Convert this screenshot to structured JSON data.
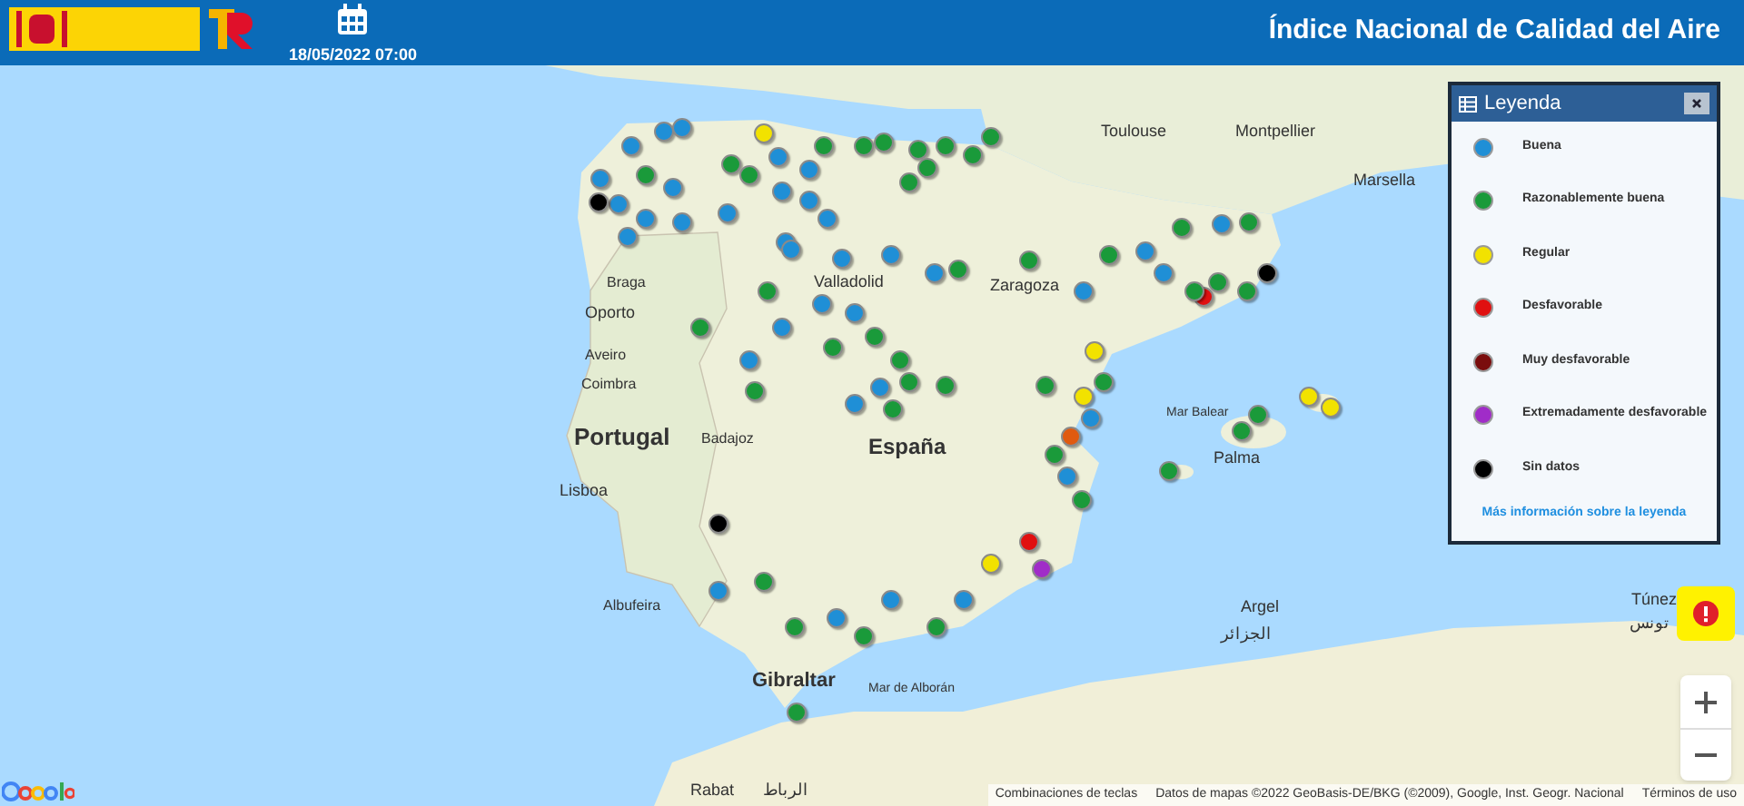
{
  "header": {
    "date": "18/05/2022 07:00",
    "title": "Índice Nacional de Calidad del Aire"
  },
  "map_labels": [
    "Toulouse",
    "Montpellier",
    "Marsella",
    "Braga",
    "Oporto",
    "Aveiro",
    "Coimbra",
    "Portugal",
    "Badajoz",
    "Lisboa",
    "Albufeira",
    "España",
    "Valladolid",
    "Zaragoza",
    "Mar Balear",
    "Palma",
    "Argel",
    "الجزائر",
    "Túnez",
    "تونس",
    "Mar de Alborán",
    "Gibraltar",
    "Rabat",
    "الرباط"
  ],
  "stations": [
    {
      "color": "#1f8fd6"
    },
    {
      "color": "#1f8fd6"
    },
    {
      "color": "#1f8fd6"
    },
    {
      "color": "#1f8fd6"
    },
    {
      "color": "#1f8fd6"
    },
    {
      "color": "#1a9a3a"
    },
    {
      "color": "#1f8fd6"
    },
    {
      "color": "#1f8fd6"
    },
    {
      "color": "#1f8fd6"
    },
    {
      "color": "#1f8fd6"
    },
    {
      "color": "#000000"
    },
    {
      "color": "#f2e200"
    },
    {
      "color": "#1a9a3a"
    },
    {
      "color": "#1a9a3a"
    },
    {
      "color": "#1f8fd6"
    },
    {
      "color": "#1f8fd6"
    },
    {
      "color": "#1a9a3a"
    },
    {
      "color": "#1a9a3a"
    },
    {
      "color": "#1a9a3a"
    },
    {
      "color": "#1a9a3a"
    },
    {
      "color": "#1a9a3a"
    },
    {
      "color": "#1a9a3a"
    },
    {
      "color": "#1a9a3a"
    },
    {
      "color": "#1a9a3a"
    },
    {
      "color": "#1f8fd6"
    },
    {
      "color": "#1a9a3a"
    },
    {
      "color": "#1f8fd6"
    },
    {
      "color": "#1f8fd6"
    },
    {
      "color": "#1f8fd6"
    },
    {
      "color": "#1f8fd6"
    },
    {
      "color": "#1f8fd6"
    },
    {
      "color": "#1f8fd6"
    },
    {
      "color": "#1f8fd6"
    },
    {
      "color": "#1f8fd6"
    },
    {
      "color": "#1a9a3a"
    },
    {
      "color": "#1f8fd6"
    },
    {
      "color": "#1a9a3a"
    },
    {
      "color": "#1f8fd6"
    },
    {
      "color": "#1f8fd6"
    },
    {
      "color": "#1a9a3a"
    },
    {
      "color": "#1a9a3a"
    },
    {
      "color": "#1f8fd6"
    },
    {
      "color": "#1a9a3a"
    },
    {
      "color": "#1a9a3a"
    },
    {
      "color": "#1a9a3a"
    },
    {
      "color": "#1a9a3a"
    },
    {
      "color": "#1f8fd6"
    },
    {
      "color": "#1a9a3a"
    },
    {
      "color": "#1f8fd6"
    },
    {
      "color": "#1a9a3a"
    },
    {
      "color": "#e01010"
    },
    {
      "color": "#000000"
    },
    {
      "color": "#f2e200"
    },
    {
      "color": "#f2e200"
    },
    {
      "color": "#e05a10"
    },
    {
      "color": "#1a9a3a"
    },
    {
      "color": "#1f8fd6"
    },
    {
      "color": "#1a9a3a"
    },
    {
      "color": "#1f8fd6"
    },
    {
      "color": "#1a9a3a"
    },
    {
      "color": "#f2e200"
    },
    {
      "color": "#f2e200"
    },
    {
      "color": "#1a9a3a"
    },
    {
      "color": "#1a9a3a"
    },
    {
      "color": "#1a9a3a"
    },
    {
      "color": "#1f8fd6"
    },
    {
      "color": "#1a9a3a"
    },
    {
      "color": "#1f8fd6"
    },
    {
      "color": "#1a9a3a"
    },
    {
      "color": "#1a9a3a"
    },
    {
      "color": "#1a9a3a"
    },
    {
      "color": "#1a9a3a"
    },
    {
      "color": "#1f8fd6"
    },
    {
      "color": "#f2e200"
    },
    {
      "color": "#e01010"
    },
    {
      "color": "#a02cc8"
    },
    {
      "color": "#1a9a3a"
    },
    {
      "color": "#1a9a3a"
    },
    {
      "color": "#1f8fd6"
    },
    {
      "color": "#1a9a3a"
    },
    {
      "color": "#1a9a3a"
    },
    {
      "color": "#1a9a3a"
    },
    {
      "color": "#1f8fd6"
    },
    {
      "color": "#1f8fd6"
    },
    {
      "color": "#1a9a3a"
    },
    {
      "color": "#000000"
    },
    {
      "color": "#1f8fd6"
    },
    {
      "color": "#1a9a3a"
    },
    {
      "color": "#1f8fd6"
    },
    {
      "color": "#1a9a3a"
    }
  ],
  "legend": {
    "title": "Leyenda",
    "items": [
      {
        "label": "Buena",
        "color": "#1f8fd6"
      },
      {
        "label": "Razonablemente buena",
        "color": "#1a9a3a"
      },
      {
        "label": "Regular",
        "color": "#f2e200"
      },
      {
        "label": "Desfavorable",
        "color": "#e01010"
      },
      {
        "label": "Muy desfavorable",
        "color": "#7a0d0d"
      },
      {
        "label": "Extremadamente desfavorable",
        "color": "#a02cc8"
      },
      {
        "label": "Sin datos",
        "color": "#000000"
      }
    ],
    "link": "Más información sobre la leyenda"
  },
  "attribution": [
    "Combinaciones de teclas",
    "Datos de mapas ©2022 GeoBasis-DE/BKG (©2009), Google, Inst. Geogr. Nacional",
    "Términos de uso"
  ]
}
